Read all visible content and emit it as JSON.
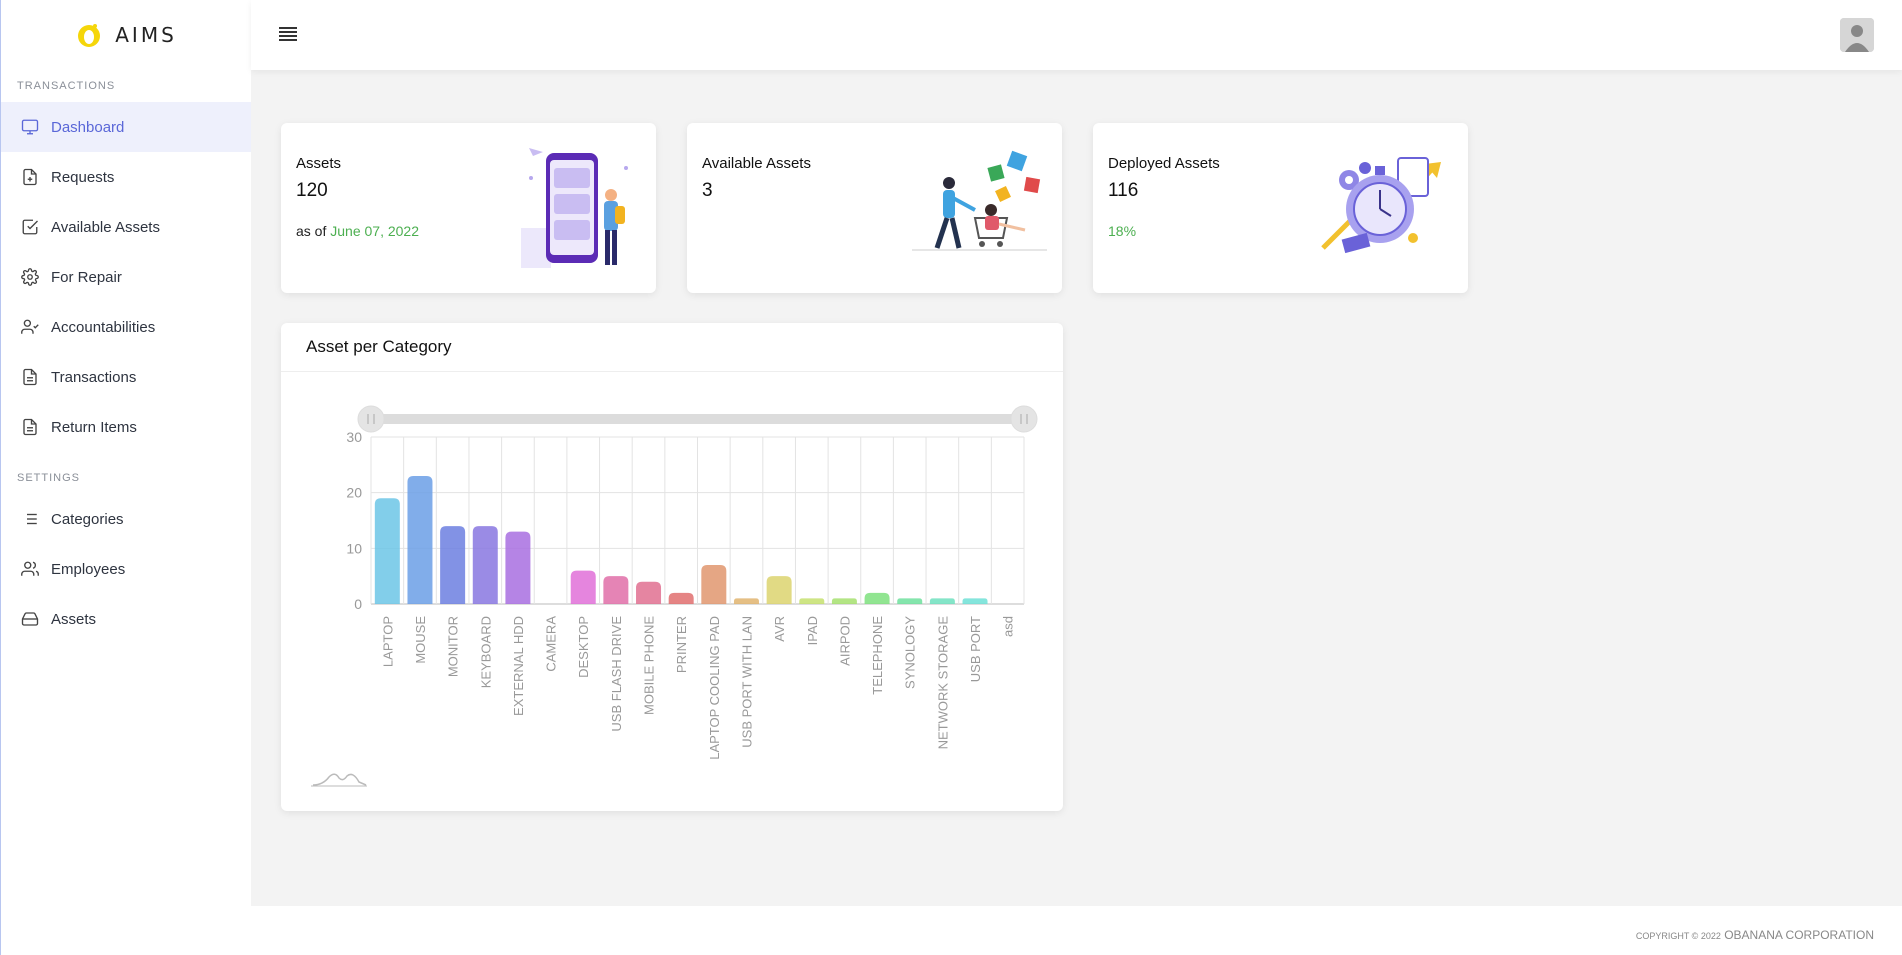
{
  "brand": {
    "name": "AIMS"
  },
  "sidebar": {
    "sections": [
      {
        "label": "TRANSACTIONS"
      },
      {
        "label": "SETTINGS"
      }
    ],
    "items": [
      {
        "label": "Dashboard",
        "icon": "monitor-icon"
      },
      {
        "label": "Requests",
        "icon": "file-plus-icon"
      },
      {
        "label": "Available Assets",
        "icon": "check-square-icon"
      },
      {
        "label": "For Repair",
        "icon": "gear-icon"
      },
      {
        "label": "Accountabilities",
        "icon": "user-check-icon"
      },
      {
        "label": "Transactions",
        "icon": "file-text-icon"
      },
      {
        "label": "Return Items",
        "icon": "file-text-icon"
      },
      {
        "label": "Categories",
        "icon": "list-icon"
      },
      {
        "label": "Employees",
        "icon": "users-icon"
      },
      {
        "label": "Assets",
        "icon": "hard-drive-icon"
      }
    ]
  },
  "cards": {
    "assets": {
      "title": "Assets",
      "value": "120",
      "sub_prefix": "as of",
      "sub_date": "June 07, 2022"
    },
    "available": {
      "title": "Available Assets",
      "value": "3"
    },
    "deployed": {
      "title": "Deployed Assets",
      "value": "116",
      "percent": "18%"
    }
  },
  "chart_card": {
    "title": "Asset per Category"
  },
  "chart_data": {
    "type": "bar",
    "title": "",
    "xlabel": "",
    "ylabel": "",
    "ylim": [
      0,
      30
    ],
    "yticks": [
      0,
      10,
      20,
      30
    ],
    "categories": [
      "LAPTOP",
      "MOUSE",
      "MONITOR",
      "KEYBOARD",
      "EXTERNAL HDD",
      "CAMERA",
      "DESKTOP",
      "USB FLASH DRIVE",
      "MOBILE PHONE",
      "PRINTER",
      "LAPTOP COOLING PAD",
      "USB PORT WITH LAN",
      "AVR",
      "IPAD",
      "AIRPOD",
      "TELEPHONE",
      "SYNOLOGY",
      "NETWORK STORAGE",
      "USB PORT",
      "asd"
    ],
    "values": [
      19,
      23,
      14,
      14,
      13,
      0,
      6,
      5,
      4,
      2,
      7,
      1,
      5,
      1,
      1,
      2,
      1,
      1,
      1,
      0
    ],
    "colors": [
      "#6cc5e6",
      "#6b9fe6",
      "#6c7fe0",
      "#8877e0",
      "#a86fe0",
      "#c46fe0",
      "#e070d8",
      "#e06fa8",
      "#e07090",
      "#e06e6e",
      "#e0966e",
      "#e0b46e",
      "#dcd36e",
      "#c6e06e",
      "#a6e06e",
      "#7ee07e",
      "#6ee09e",
      "#6ee0be",
      "#6ee0d6",
      "#6ec8e0"
    ],
    "grid": true,
    "legend": "none"
  },
  "footer": {
    "small": "COPYRIGHT © 2022",
    "company": "OBANANA CORPORATION"
  }
}
